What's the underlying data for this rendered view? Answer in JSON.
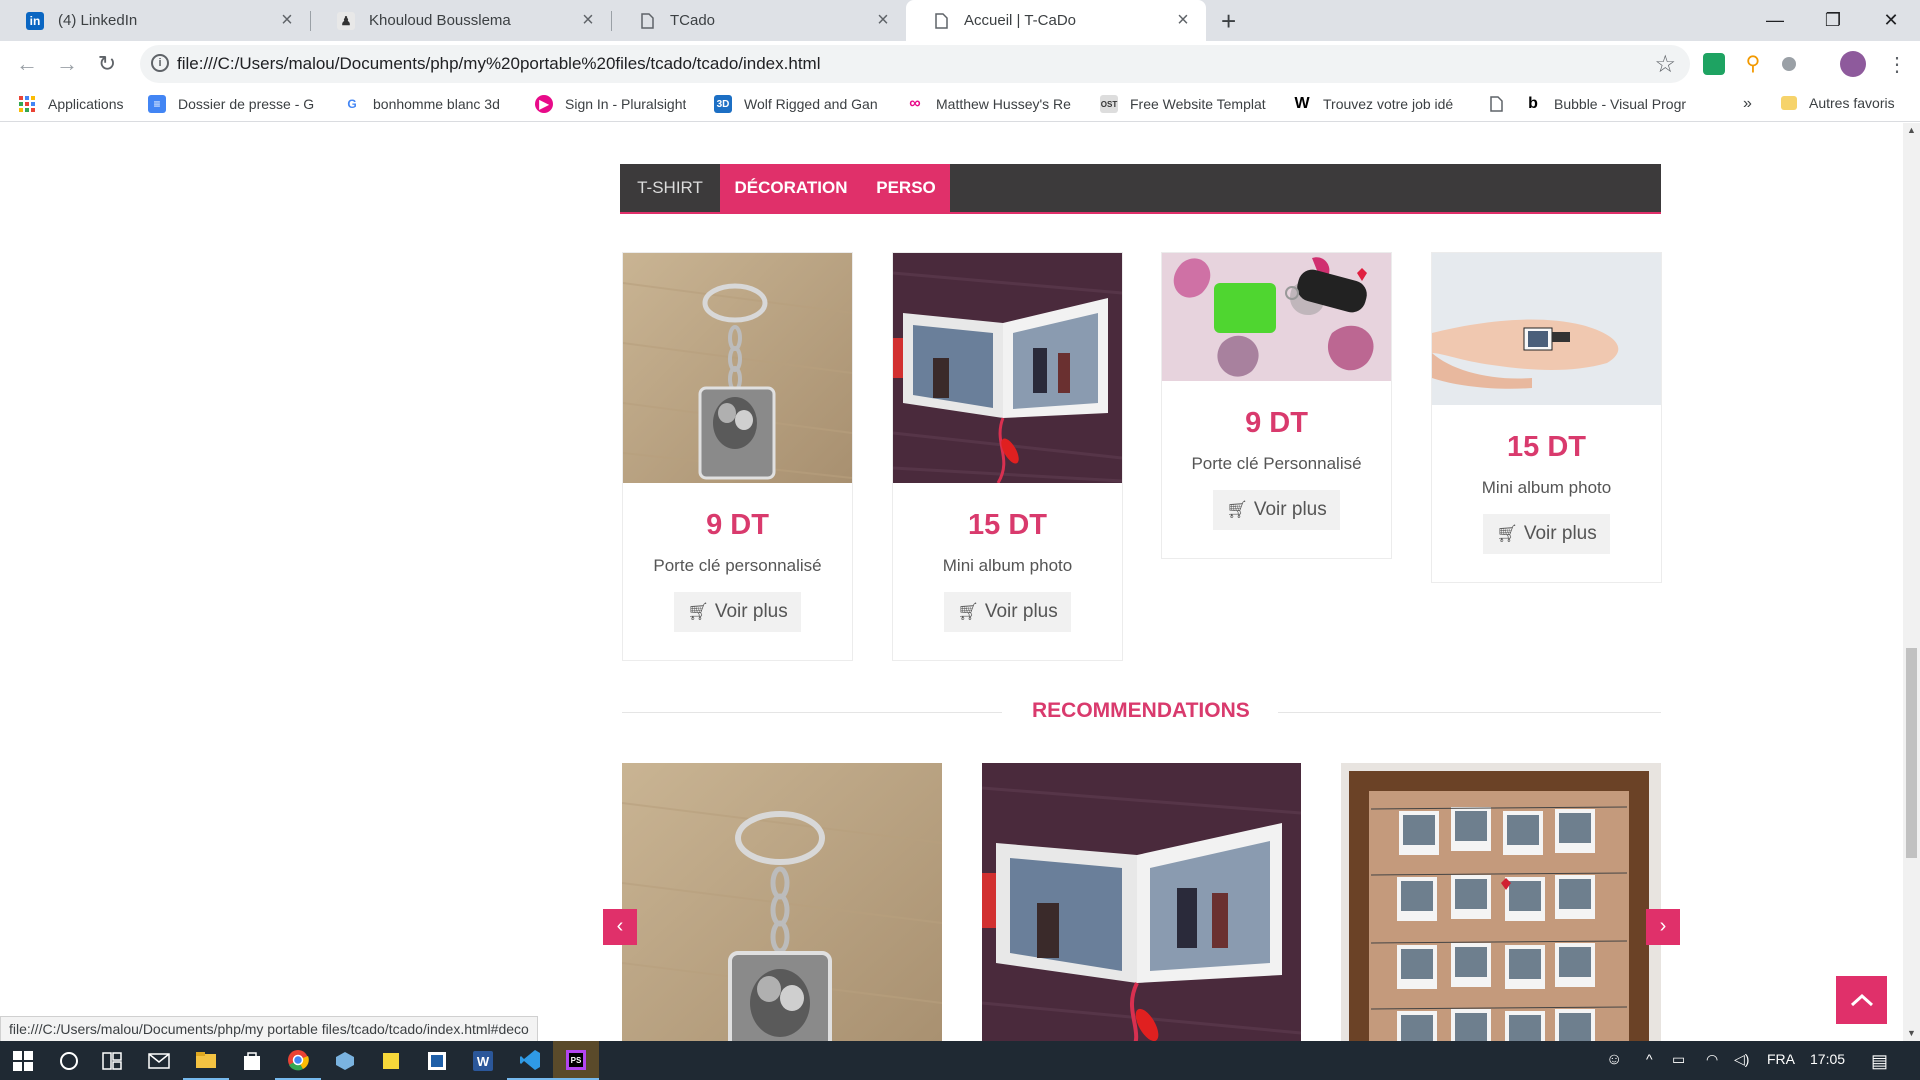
{
  "browser": {
    "tabs": [
      {
        "title": "(4) LinkedIn",
        "icon": "linkedin-icon"
      },
      {
        "title": "Khouloud Bousslema",
        "icon": "profile-icon"
      },
      {
        "title": "TCado",
        "icon": "page-icon"
      },
      {
        "title": "Accueil | T-CaDo",
        "icon": "page-icon",
        "active": true
      }
    ],
    "url": "file:///C:/Users/malou/Documents/php/my%20portable%20files/tcado/tcado/index.html",
    "bookmarks": [
      {
        "label": "Applications",
        "icon": "apps-grid-icon"
      },
      {
        "label": "Dossier de presse - G",
        "icon": "docs-icon"
      },
      {
        "label": "bonhomme blanc 3d",
        "icon": "google-icon"
      },
      {
        "label": "Sign In - Pluralsight",
        "icon": "pluralsight-icon"
      },
      {
        "label": "Wolf Rigged and Gan",
        "icon": "3d-icon"
      },
      {
        "label": "Matthew Hussey's Re",
        "icon": "circles-icon"
      },
      {
        "label": "Free Website Templat",
        "icon": "ost-icon"
      },
      {
        "label": "Trouvez votre job idé",
        "icon": "w-icon"
      },
      {
        "label": "",
        "icon": "page-icon"
      },
      {
        "label": "Bubble - Visual Progr",
        "icon": "bubble-icon"
      }
    ],
    "bookmarks_more": "»",
    "other_bookmarks": "Autres favoris",
    "status_url": "file:///C:/Users/malou/Documents/php/my portable files/tcado/tcado/index.html#deco"
  },
  "categories": {
    "items": [
      "T-SHIRT",
      "DÉCORATION",
      "PERSO"
    ]
  },
  "products": [
    {
      "price": "9 DT",
      "name": "Porte clé personnalisé",
      "button": "Voir plus",
      "image": "keychain-photo"
    },
    {
      "price": "15 DT",
      "name": "Mini album photo",
      "button": "Voir plus",
      "image": "mini-album-photo"
    },
    {
      "price": "9 DT",
      "name": "Porte clé Personnalisé",
      "button": "Voir plus",
      "image": "green-keychain-photo"
    },
    {
      "price": "15 DT",
      "name": "Mini album photo",
      "button": "Voir plus",
      "image": "hand-mini-album-photo"
    }
  ],
  "recommendations": {
    "title": "RECOMMENDATIONS",
    "items": [
      "keychain-photo",
      "mini-album-photo",
      "photo-frame-photo"
    ]
  },
  "taskbar": {
    "language": "FRA",
    "time": "17:05"
  },
  "colors": {
    "accent": "#e0306a",
    "price": "#d93a6d",
    "category_bar": "#3c3a3b"
  }
}
